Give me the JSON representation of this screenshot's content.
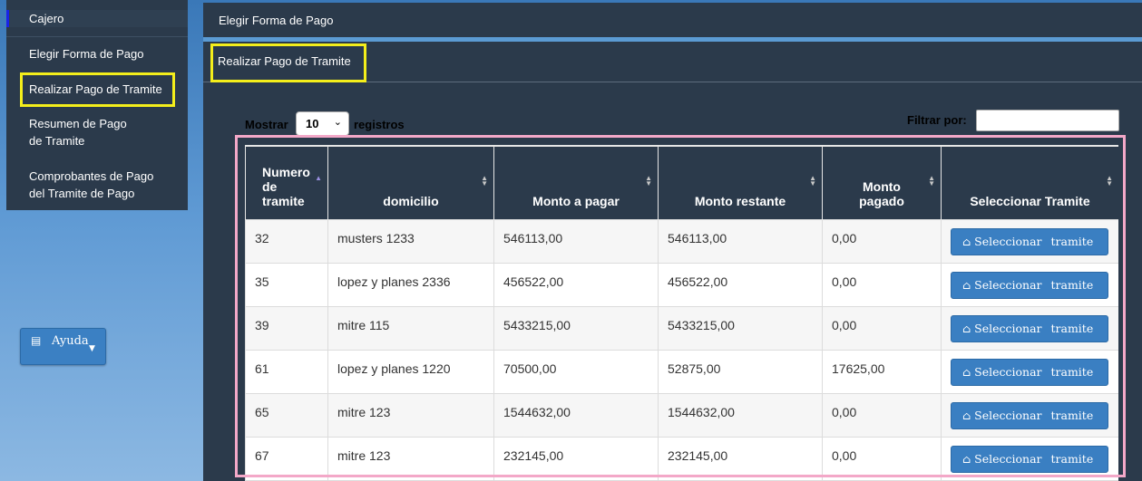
{
  "sidebar": {
    "items": [
      {
        "label": "Cajero"
      },
      {
        "label": "Elegir Forma de Pago"
      },
      {
        "label": "Realizar Pago de Tramite"
      },
      {
        "label": "Resumen de Pago de Tramite"
      },
      {
        "label": "Comprobantes de Pago del Tramite de Pago"
      }
    ],
    "help_label": "Ayuda",
    "help_icon": "list-icon"
  },
  "topbar": {
    "title": "Elegir Forma de Pago"
  },
  "main": {
    "title": "Realizar Pago de Tramite"
  },
  "datatable": {
    "length_label": "Mostrar",
    "length_value": "10",
    "length_suffix": "registros",
    "filter_label": "Filtrar por:",
    "filter_value": "",
    "columns": [
      "Numero de tramite",
      "domicilio",
      "Monto a pagar",
      "Monto restante",
      "Monto pagado",
      "Seleccionar Tramite"
    ],
    "rows": [
      {
        "numero": "32",
        "domicilio": "musters 1233",
        "monto_pagar": "546113,00",
        "monto_restante": "546113,00",
        "monto_pagado": "0,00",
        "action": "Seleccionar tramite"
      },
      {
        "numero": "35",
        "domicilio": "lopez y planes 2336",
        "monto_pagar": "456522,00",
        "monto_restante": "456522,00",
        "monto_pagado": "0,00",
        "action": "Seleccionar tramite"
      },
      {
        "numero": "39",
        "domicilio": "mitre 115",
        "monto_pagar": "5433215,00",
        "monto_restante": "5433215,00",
        "monto_pagado": "0,00",
        "action": "Seleccionar tramite"
      },
      {
        "numero": "61",
        "domicilio": "lopez y planes 1220",
        "monto_pagar": "70500,00",
        "monto_restante": "52875,00",
        "monto_pagado": "17625,00",
        "action": "Seleccionar tramite"
      },
      {
        "numero": "65",
        "domicilio": "mitre 123",
        "monto_pagar": "1544632,00",
        "monto_restante": "1544632,00",
        "monto_pagado": "0,00",
        "action": "Seleccionar tramite"
      },
      {
        "numero": "67",
        "domicilio": "mitre 123",
        "monto_pagar": "232145,00",
        "monto_restante": "232145,00",
        "monto_pagado": "0,00",
        "action": "Seleccionar tramite"
      }
    ]
  },
  "colors": {
    "panel": "#2b3a4b",
    "button": "#3a7fc2",
    "highlight_yellow": "#f4ee1b",
    "highlight_pink": "#f3a8c8"
  }
}
